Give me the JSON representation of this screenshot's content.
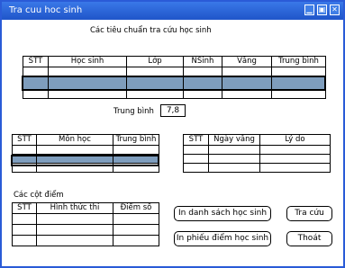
{
  "window": {
    "title": "Tra cuu hoc sinh",
    "controls": [
      "minimize-icon",
      "restore-icon",
      "close-icon"
    ]
  },
  "criteria_label": "Các tiêu chuẩn tra cứu học sinh",
  "students_table": {
    "headers": [
      "STT",
      "Học sinh",
      "Lớp",
      "NSinh",
      "Vắng",
      "Trung bình"
    ]
  },
  "average": {
    "label": "Trung bình",
    "value": "7,8"
  },
  "subjects_table": {
    "headers": [
      "STT",
      "Môn học",
      "Trung bình"
    ]
  },
  "absences_table": {
    "headers": [
      "STT",
      "Ngày vắng",
      "Lý do"
    ]
  },
  "scores_label": "Các cột điểm",
  "scores_table": {
    "headers": [
      "STT",
      "Hình thức thi",
      "Điểm số"
    ]
  },
  "buttons": {
    "print_list": "In danh sách học sinh",
    "search": "Tra cứu",
    "print_report": "In phiếu điểm học sinh",
    "exit": "Thoát"
  }
}
